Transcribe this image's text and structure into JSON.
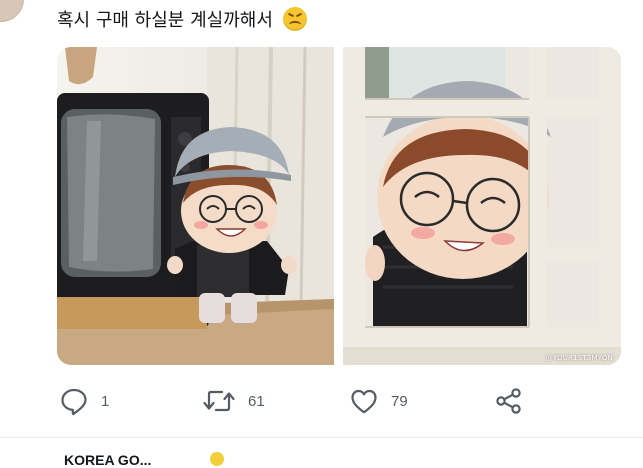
{
  "tweet": {
    "text": "혹시 구매 하실분 계실까해서",
    "emoji": "confounded-face-emoji"
  },
  "media": {
    "left_photo": "plush-doll-by-tv-image",
    "right_photo": "plush-doll-window-image",
    "photo_credit": "@YOUR1ST3MYON"
  },
  "actions": {
    "reply_count": "1",
    "retweet_count": "61",
    "like_count": "79"
  },
  "next_tweet": {
    "author": "KOREA GO..."
  },
  "colors": {
    "icon_gray": "#555c63",
    "divider": "#e6ecf0",
    "text": "#14171a"
  }
}
